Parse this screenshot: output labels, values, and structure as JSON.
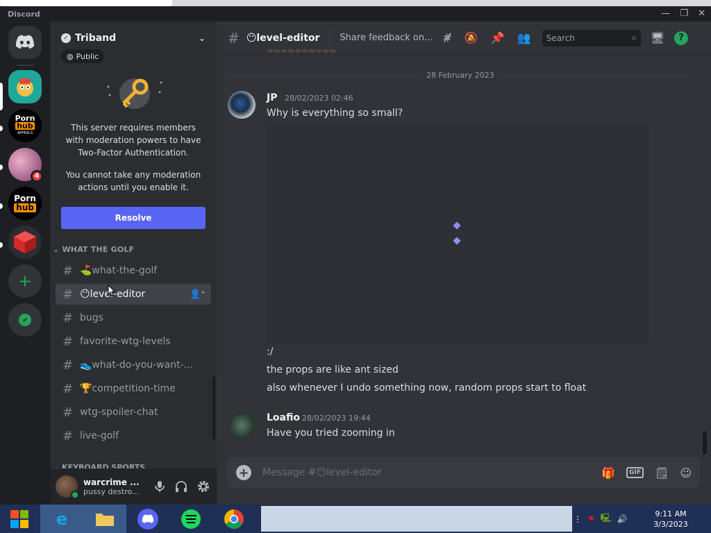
{
  "window": {
    "brand": "Discord",
    "controls": [
      "—",
      "❐",
      "✕"
    ]
  },
  "server": {
    "name": "Triband",
    "visibility": "Public",
    "tfa_message": "This server requires members with moderation powers to have Two-Factor Authentication.",
    "tfa_note": "You cannot take any moderation actions until you enable it.",
    "resolve_label": "Resolve",
    "category": "WHAT THE GOLF",
    "category2": "KEYBOARD SPORTS",
    "channels": [
      {
        "name": "⛳what-the-golf",
        "active": false
      },
      {
        "name": "😶level-editor",
        "active": true
      },
      {
        "name": "bugs",
        "active": false
      },
      {
        "name": "favorite-wtg-levels",
        "active": false
      },
      {
        "name": "👟what-do-you-want-...",
        "active": false
      },
      {
        "name": "🏆competition-time",
        "active": false
      },
      {
        "name": "wtg-spoiler-chat",
        "active": false
      },
      {
        "name": "live-golf",
        "active": false
      }
    ]
  },
  "guilds": {
    "badge_count": "4",
    "items": [
      "Direct Messages",
      "Triband",
      "Pornhub Appeals",
      "Server",
      "Pornhub",
      "Roblox"
    ]
  },
  "user": {
    "name": "warcrime ...",
    "status": "pussy destro..."
  },
  "channel_header": {
    "name": "😶level-editor",
    "topic": "Share feedback on...",
    "search_placeholder": "Search"
  },
  "messages": {
    "date_divider": "28 February 2023",
    "m1": {
      "author": "JP",
      "timestamp": "28/02/2023 02:46",
      "text": "Why is everything so small?",
      "followups": [
        ":/",
        "the props are like ant sized",
        "also whenever I undo something now, random props start to float"
      ]
    },
    "m2": {
      "author": "Loafio",
      "timestamp": "28/02/2023 19:44",
      "text": "Have you tried zooming in"
    }
  },
  "composer": {
    "placeholder": "Message #😶level-editor",
    "gif_label": "GIF"
  },
  "taskbar": {
    "time": "9:11 AM",
    "date": "3/3/2023"
  },
  "colors": {
    "blurple": "#5865f2",
    "green": "#23a55a",
    "red": "#f23f43"
  }
}
